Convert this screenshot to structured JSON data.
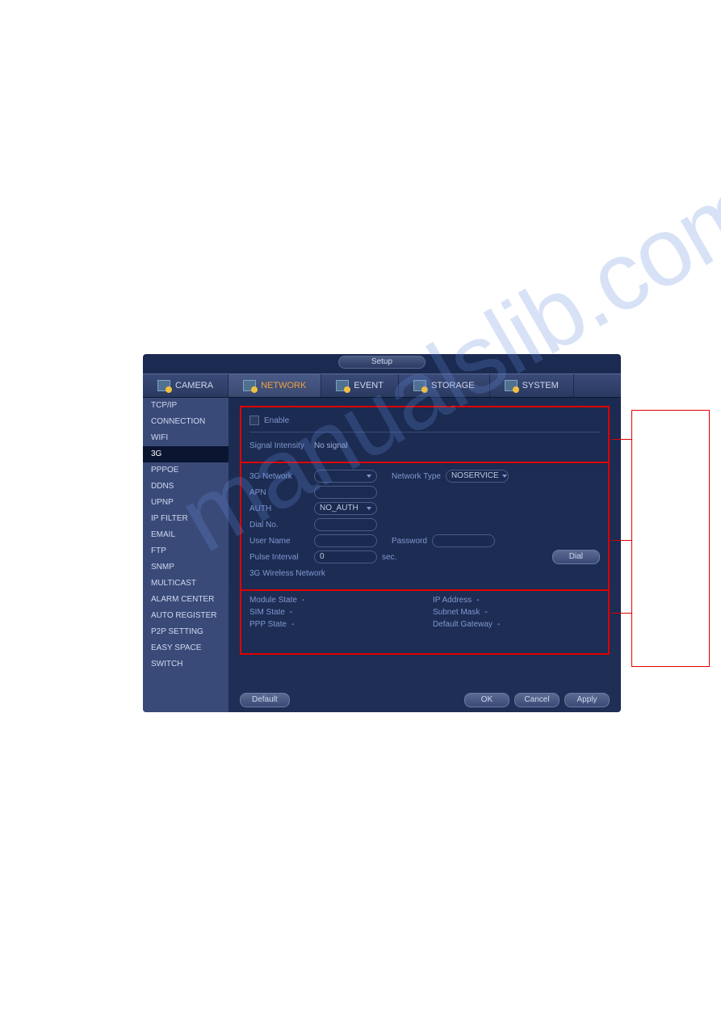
{
  "window": {
    "title": "Setup"
  },
  "tabs": [
    {
      "label": "CAMERA",
      "active": false
    },
    {
      "label": "NETWORK",
      "active": true
    },
    {
      "label": "EVENT",
      "active": false
    },
    {
      "label": "STORAGE",
      "active": false
    },
    {
      "label": "SYSTEM",
      "active": false
    }
  ],
  "sidebar": {
    "items": [
      "TCP/IP",
      "CONNECTION",
      "WIFI",
      "3G",
      "PPPOE",
      "DDNS",
      "UPNP",
      "IP FILTER",
      "EMAIL",
      "FTP",
      "SNMP",
      "MULTICAST",
      "ALARM CENTER",
      "AUTO REGISTER",
      "P2P SETTING",
      "EASY SPACE",
      "SWITCH"
    ],
    "activeIndex": 3
  },
  "pane1": {
    "enable_label": "Enable",
    "signal_intensity_label": "Signal Intensity",
    "signal_intensity_value": "No signal"
  },
  "pane2": {
    "network_label": "3G Network",
    "network_value": "",
    "network_type_label": "Network Type",
    "network_type_value": "NOSERVICE",
    "apn_label": "APN",
    "apn_value": "",
    "auth_label": "AUTH",
    "auth_value": "NO_AUTH",
    "dial_no_label": "Dial No.",
    "dial_no_value": "",
    "user_name_label": "User Name",
    "user_name_value": "",
    "password_label": "Password",
    "password_value": "",
    "pulse_interval_label": "Pulse Interval",
    "pulse_interval_value": "0",
    "pulse_interval_unit": "sec.",
    "dial_button": "Dial",
    "wireless_header": "3G Wireless Network"
  },
  "pane3": {
    "module_state_label": "Module State",
    "module_state_value": "-",
    "sim_state_label": "SIM State",
    "sim_state_value": "-",
    "ppp_state_label": "PPP State",
    "ppp_state_value": "-",
    "ip_address_label": "IP Address",
    "ip_address_value": "-",
    "subnet_mask_label": "Subnet Mask",
    "subnet_mask_value": "-",
    "default_gateway_label": "Default Gateway",
    "default_gateway_value": "-"
  },
  "footer": {
    "default": "Default",
    "ok": "OK",
    "cancel": "Cancel",
    "apply": "Apply"
  },
  "watermark": "manualslib.com"
}
